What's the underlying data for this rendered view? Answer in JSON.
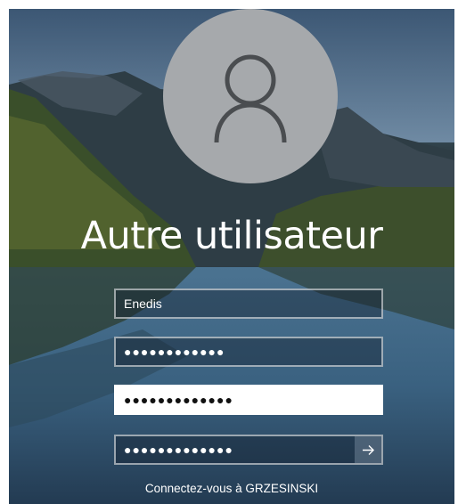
{
  "window": {
    "screen_title": "Autre utilisateur"
  },
  "icons": {
    "avatar": "user-avatar-icon",
    "submit": "arrow-right-icon"
  },
  "fields": {
    "username": {
      "value": "Enedis"
    },
    "password1": {
      "value": "●●●●●●●●●●●●"
    },
    "password2": {
      "value": "●●●●●●●●●●●●●"
    },
    "password3": {
      "value": "●●●●●●●●●●●●●"
    }
  },
  "footer": {
    "connect_text": "Connectez-vous à GRZESINSKI"
  },
  "colors": {
    "avatar_bg": "#a6a9ac",
    "focus_field": "#ffffff",
    "text": "#ffffff"
  }
}
